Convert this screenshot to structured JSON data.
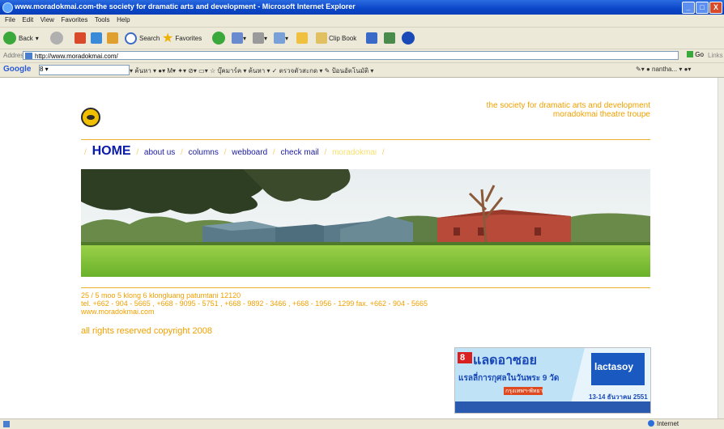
{
  "window": {
    "title": "www.moradokmai.com-the society for dramatic arts and development - Microsoft Internet Explorer",
    "buttons": {
      "minimize": "_",
      "maximize": "□",
      "close": "X"
    }
  },
  "menu": [
    "File",
    "Edit",
    "View",
    "Favorites",
    "Tools",
    "Help"
  ],
  "toolbar": {
    "back": "Back",
    "search": "Search",
    "favorites": "Favorites",
    "clipbook": "Clip Book"
  },
  "address": {
    "label": "Address",
    "url": "http://www.moradokmai.com/",
    "go": "Go",
    "links": "Links"
  },
  "googlebar": {
    "logo": "Google",
    "search_value": "8 ▾",
    "items": "▾ ค้นหา ▾  ●▾  M▾  ✦▾  ⊘▾  ▭▾  ☆ บุ๊คมาร์ค ▾   ค้นหา ▾  ✓ ตรวจตัวสะกด ▾  ✎ ป้อนอัตโนมัติ ▾",
    "right": "✎▾  ● nantha... ▾  ●▾"
  },
  "page": {
    "tagline_line1": "the society for dramatic arts and development",
    "tagline_line2": "moradokmai theatre troupe",
    "nav": {
      "home": "HOME",
      "about": "about us",
      "columns": "columns",
      "webboard": "webboard",
      "checkmail": "check mail",
      "current": "moradokmai",
      "sep": "/"
    },
    "address_line": "25 / 5 moo 5 klong 6  klongluang patumtani 12120",
    "tel_line": "tel. +662 - 904 - 5665 , +668 - 9095 - 5751 , +668 - 9892 - 3466 , +668 - 1956 - 1299   fax. +662 - 904 - 5665",
    "web_line": "www.moradokmai.com",
    "copyright": "all rights reserved   copyright 2008",
    "ad": {
      "brand": "lactasoy",
      "headline": "แลดอาซอย",
      "subline": "แรลลี่การกุศลในวันพระ 9 วัด",
      "route": "กรุงเทพฯ-พัทยา",
      "date": "13-14 ธันวาคม 2551",
      "badge": "8"
    }
  },
  "status": {
    "zone": "Internet"
  },
  "colors": {
    "accent": "#f0a000",
    "nav_link": "#1a1aa0",
    "home": "#0a1aa8"
  }
}
